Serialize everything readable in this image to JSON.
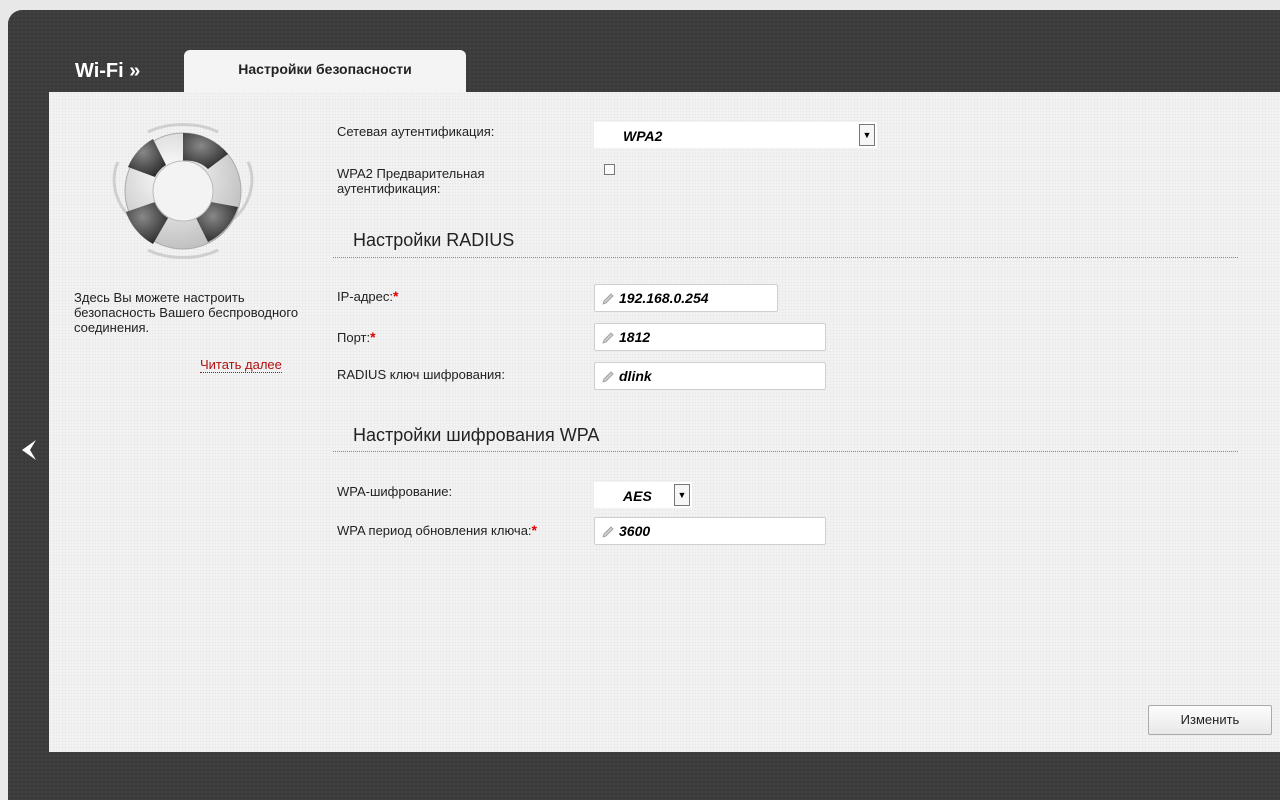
{
  "header": {
    "section_title": "Wi-Fi »",
    "active_tab": "Настройки безопасности"
  },
  "sidebar": {
    "help_text": "Здесь Вы можете настроить безопасность Вашего беспроводного соединения.",
    "read_more": "Читать далее"
  },
  "form": {
    "auth": {
      "label": "Сетевая аутентификация:",
      "value": "WPA2"
    },
    "preauth": {
      "label": "WPA2 Предварительная аутентификация:",
      "checked": false
    },
    "radius_section": "Настройки RADIUS",
    "ip": {
      "label": "IP-адрес:",
      "required": "*",
      "value": "192.168.0.254"
    },
    "port": {
      "label": "Порт:",
      "required": "*",
      "value": "1812"
    },
    "radius_key": {
      "label": "RADIUS ключ шифрования:",
      "value": "dlink"
    },
    "wpa_section": "Настройки шифрования WPA",
    "wpa_enc": {
      "label": "WPA-шифрование:",
      "value": "AES"
    },
    "wpa_period": {
      "label": "WPA период обновления ключа:",
      "required": "*",
      "value": "3600"
    }
  },
  "actions": {
    "apply_label": "Изменить"
  },
  "colors": {
    "required": "#e00000",
    "link": "#b01010",
    "frame": "#3b3b3b"
  },
  "icons": [
    "back-arrow-icon",
    "lifebuoy-icon",
    "pencil-icon",
    "dropdown-arrow-icon"
  ]
}
